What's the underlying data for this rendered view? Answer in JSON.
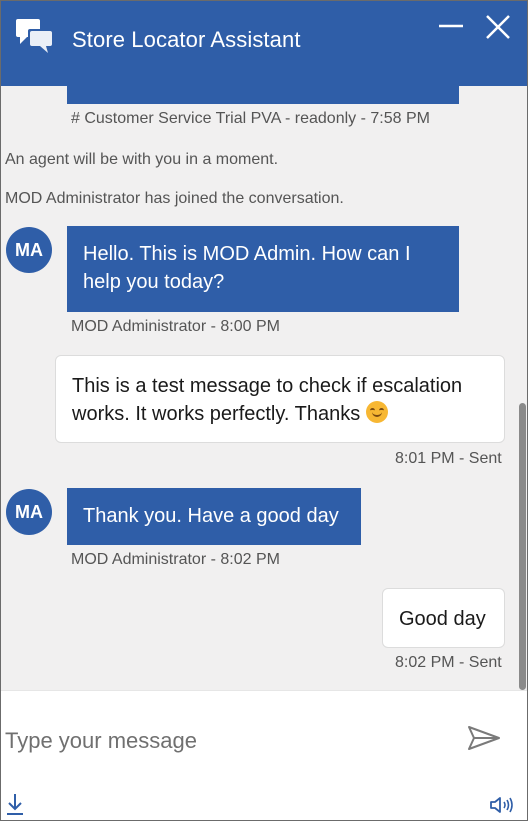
{
  "header": {
    "title": "Store Locator Assistant",
    "chat_icon": "chat-bubbles-icon",
    "minimize_icon": "minimize-icon",
    "close_icon": "close-icon",
    "color": "#2f5ea8"
  },
  "transcript": {
    "prev_meta": "# Customer Service Trial PVA - readonly - 7:58 PM",
    "system_messages": [
      "An agent will be with you in a moment.",
      "MOD Administrator has joined the conversation."
    ],
    "messages": [
      {
        "from": "bot",
        "avatar": "MA",
        "lines": [
          "Hello. This is MOD Admin. How can I",
          "help you today?"
        ],
        "meta": "MOD Administrator - 8:00 PM"
      },
      {
        "from": "user",
        "lines": [
          "This is a test message to check if escalation",
          "works. It works perfectly. Thanks"
        ],
        "emoji": "smiling-face-emoji",
        "meta": "8:01 PM - Sent"
      },
      {
        "from": "bot",
        "avatar": "MA",
        "lines": [
          "Thank you. Have a good day"
        ],
        "meta": "MOD Administrator - 8:02 PM"
      },
      {
        "from": "user",
        "lines": [
          "Good day"
        ],
        "meta": "8:02 PM - Sent"
      }
    ]
  },
  "input": {
    "placeholder": "Type your message",
    "value": "",
    "send_icon": "send-icon",
    "download_icon": "download-icon",
    "speaker_icon": "speaker-icon"
  }
}
